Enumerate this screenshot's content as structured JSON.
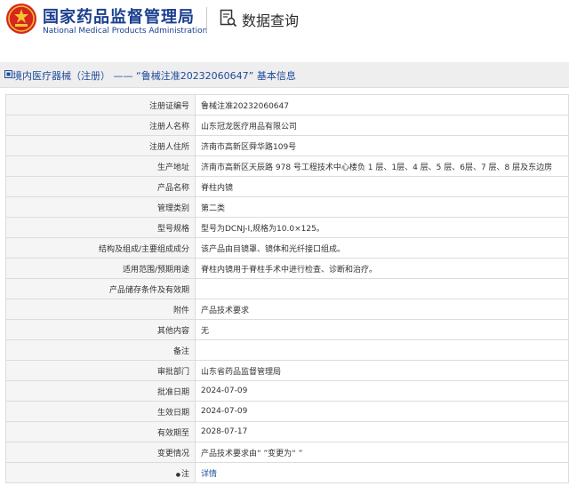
{
  "header": {
    "logo_cn": "国家药品监督管理局",
    "logo_en": "National Medical Products Administration",
    "section_title": "数据查询"
  },
  "breadcrumb": {
    "text": "境内医疗器械（注册） —— “鲁械注准20232060647” 基本信息"
  },
  "rows": [
    {
      "label": "注册证编号",
      "value": "鲁械注准20232060647"
    },
    {
      "label": "注册人名称",
      "value": "山东冠龙医疗用品有限公司"
    },
    {
      "label": "注册人住所",
      "value": "济南市高新区舜华路109号"
    },
    {
      "label": "生产地址",
      "value": "济南市高新区天辰路 978 号工程技术中心楼负 1 层、1层、4 层、5 层、6层、7 层、8 层及东边房"
    },
    {
      "label": "产品名称",
      "value": "脊柱内镜"
    },
    {
      "label": "管理类别",
      "value": "第二类"
    },
    {
      "label": "型号规格",
      "value": "型号为DCNJ-Ⅰ,规格为10.0×125。"
    },
    {
      "label": "结构及组成/主要组成成分",
      "value": "该产品由目镜罩、镜体和光纤接口组成。"
    },
    {
      "label": "适用范围/预期用途",
      "value": "脊柱内镜用于脊柱手术中进行检查、诊断和治疗。"
    },
    {
      "label": "产品储存条件及有效期",
      "value": ""
    },
    {
      "label": "附件",
      "value": "产品技术要求"
    },
    {
      "label": "其他内容",
      "value": "无"
    },
    {
      "label": "备注",
      "value": ""
    },
    {
      "label": "审批部门",
      "value": "山东省药品监督管理局"
    },
    {
      "label": "批准日期",
      "value": "2024-07-09"
    },
    {
      "label": "生效日期",
      "value": "2024-07-09"
    },
    {
      "label": "有效期至",
      "value": "2028-07-17"
    },
    {
      "label": "变更情况",
      "value": "产品技术要求由“ ”变更为“ ”"
    }
  ],
  "note_row": {
    "label": "注",
    "link": "详情"
  },
  "colors": {
    "brand": "#1b3f8f",
    "link": "#1e4a9b",
    "emblem_red": "#d7261e",
    "emblem_gold": "#f4c430"
  }
}
